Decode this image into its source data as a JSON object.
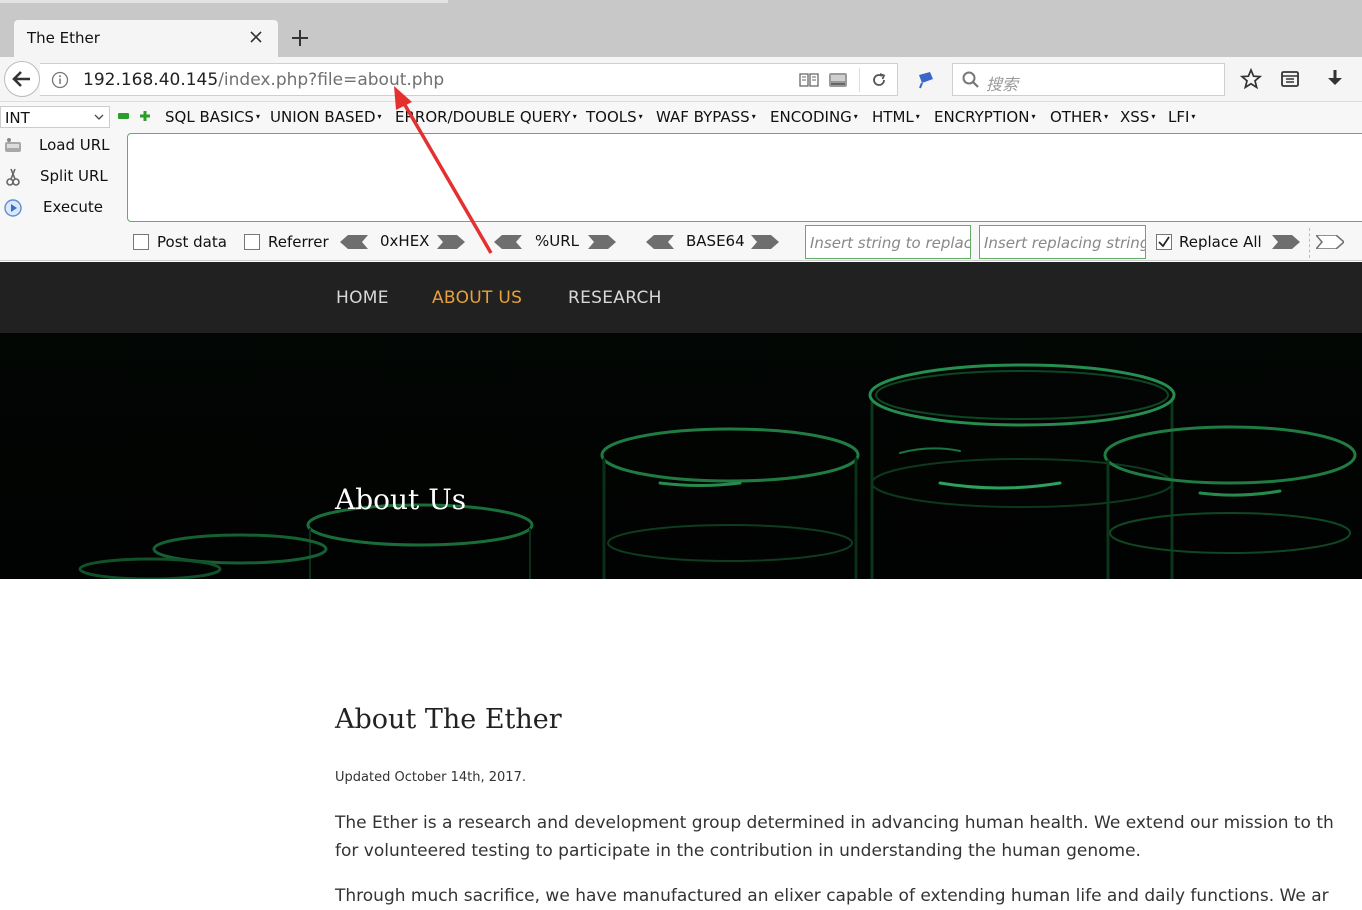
{
  "browser": {
    "tab_title": "The Ether",
    "url_host": "192.168.40.145",
    "url_path": "/index.php?file=about.php",
    "search_placeholder": "搜索"
  },
  "hackbar": {
    "select_value": "INT",
    "menu": [
      "SQL BASICS",
      "UNION BASED",
      "ERROR/DOUBLE QUERY",
      "TOOLS",
      "WAF BYPASS",
      "ENCODING",
      "HTML",
      "ENCRYPTION",
      "OTHER",
      "XSS",
      "LFI"
    ],
    "buttons": {
      "load_url": "Load URL",
      "split_url": "Split URL",
      "execute": "Execute"
    },
    "options": {
      "post_data": "Post data",
      "referrer": "Referrer",
      "hex": "0xHEX",
      "url": "%URL",
      "base64": "BASE64",
      "replace_all": "Replace All",
      "replace_all_checked": true
    },
    "replace_placeholder": "Insert string to replace",
    "replacing_placeholder": "Insert replacing string"
  },
  "site": {
    "nav": [
      "HOME",
      "ABOUT US",
      "RESEARCH"
    ],
    "active_nav": "ABOUT US",
    "hero_title": "About Us",
    "heading": "About The Ether",
    "updated": "Updated October 14th, 2017.",
    "para1_line1": "The Ether is a research and development group determined in advancing human health. We extend our mission to th",
    "para1_line2": "for volunteered testing to participate in the contribution in understanding the human genome.",
    "para2_line1": "Through much sacrifice, we have manufactured an elixer capable of extending human life and daily functions. We ar"
  },
  "colors": {
    "nav_active": "#e8a13a",
    "annotation_arrow": "#e53030",
    "hackbar_border": "#66aa66"
  }
}
